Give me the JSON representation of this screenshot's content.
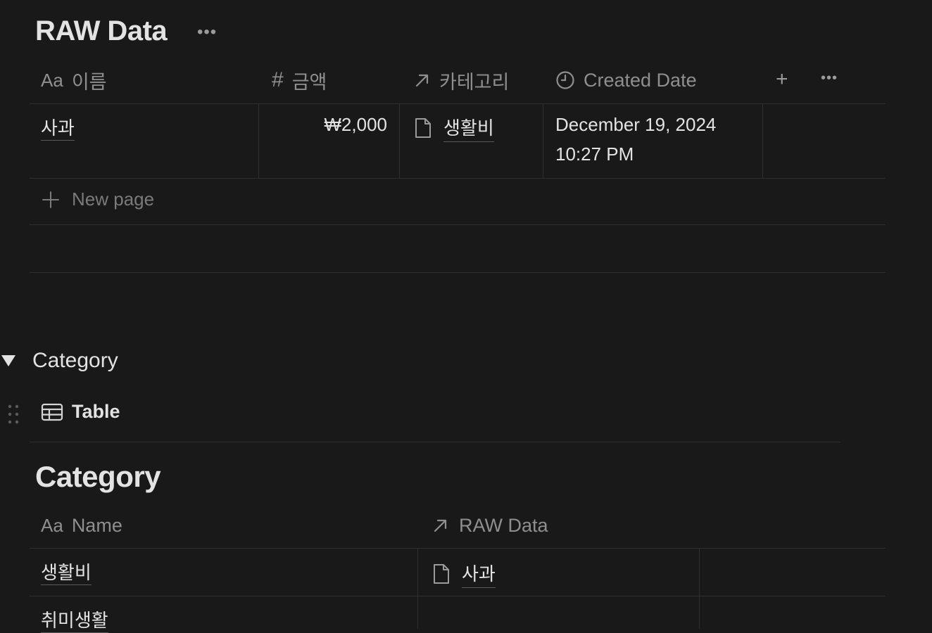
{
  "raw_table": {
    "title": "RAW Data",
    "more_label": "•••",
    "columns": [
      {
        "icon": "Aa",
        "label": "이름"
      },
      {
        "icon": "#",
        "label": "금액"
      },
      {
        "icon": "↗",
        "label": "카테고리"
      },
      {
        "icon": "clock",
        "label": "Created Date"
      }
    ],
    "add_column_label": "+",
    "column_more_label": "•••",
    "rows": [
      {
        "name": "사과",
        "amount": "₩2,000",
        "category": "생활비",
        "created_line1": "December 19, 2024",
        "created_line2": "10:27 PM"
      }
    ],
    "new_page_label": "New page"
  },
  "toggle": {
    "label": "Category"
  },
  "view_tab": {
    "label": "Table"
  },
  "category_table": {
    "title": "Category",
    "columns": [
      {
        "icon": "Aa",
        "label": "Name"
      },
      {
        "icon": "↗",
        "label": "RAW Data"
      }
    ],
    "rows": [
      {
        "name": "생활비",
        "raw_data": "사과"
      },
      {
        "name": "취미생활",
        "raw_data": ""
      }
    ]
  }
}
